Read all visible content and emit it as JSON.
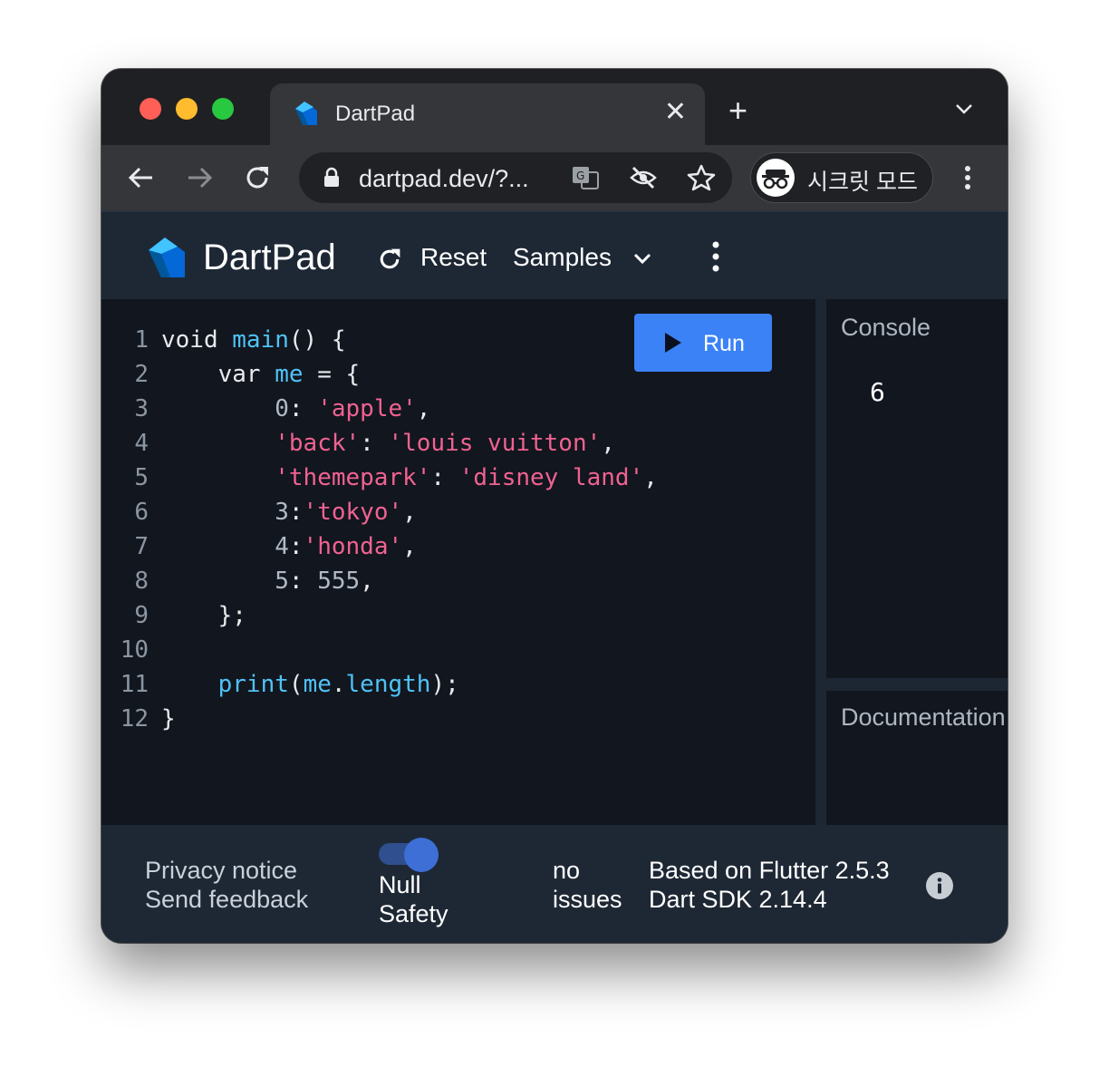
{
  "browser": {
    "tab_title": "DartPad",
    "url": "dartpad.dev/?...",
    "incognito_label": "시크릿 모드",
    "colors": {
      "close": "#ff5f57",
      "minimize": "#febc2e",
      "zoom": "#28c840"
    }
  },
  "app": {
    "name": "DartPad",
    "reset_label": "Reset",
    "samples_label": "Samples",
    "run_label": "Run"
  },
  "editor": {
    "line_numbers": [
      "1",
      "2",
      "3",
      "4",
      "5",
      "6",
      "7",
      "8",
      "9",
      "10",
      "11",
      "12"
    ],
    "lines": [
      [
        [
          "kw",
          "void "
        ],
        [
          "fn",
          "main"
        ],
        [
          "kw",
          "() {"
        ]
      ],
      [
        [
          "kw",
          "    var "
        ],
        [
          "fn",
          "me"
        ],
        [
          "kw",
          " = {"
        ]
      ],
      [
        [
          "num",
          "        0"
        ],
        [
          "kw",
          ": "
        ],
        [
          "str",
          "'apple'"
        ],
        [
          "kw",
          ","
        ]
      ],
      [
        [
          "kw",
          "        "
        ],
        [
          "str",
          "'back'"
        ],
        [
          "kw",
          ": "
        ],
        [
          "str",
          "'louis vuitton'"
        ],
        [
          "kw",
          ","
        ]
      ],
      [
        [
          "kw",
          "        "
        ],
        [
          "str",
          "'themepark'"
        ],
        [
          "kw",
          ": "
        ],
        [
          "str",
          "'disney land'"
        ],
        [
          "kw",
          ","
        ]
      ],
      [
        [
          "num",
          "        3"
        ],
        [
          "kw",
          ":"
        ],
        [
          "str",
          "'tokyo'"
        ],
        [
          "kw",
          ","
        ]
      ],
      [
        [
          "num",
          "        4"
        ],
        [
          "kw",
          ":"
        ],
        [
          "str",
          "'honda'"
        ],
        [
          "kw",
          ","
        ]
      ],
      [
        [
          "num",
          "        5"
        ],
        [
          "kw",
          ": "
        ],
        [
          "num",
          "555"
        ],
        [
          "kw",
          ","
        ]
      ],
      [
        [
          "kw",
          "    };"
        ]
      ],
      [
        [
          "kw",
          ""
        ]
      ],
      [
        [
          "kw",
          "    "
        ],
        [
          "fn",
          "print"
        ],
        [
          "kw",
          "("
        ],
        [
          "fn",
          "me"
        ],
        [
          "kw",
          "."
        ],
        [
          "fn",
          "length"
        ],
        [
          "kw",
          ");"
        ]
      ],
      [
        [
          "kw",
          "}"
        ]
      ]
    ]
  },
  "console": {
    "title": "Console",
    "output": "6"
  },
  "docs": {
    "title": "Documentation"
  },
  "footer": {
    "privacy": "Privacy notice",
    "feedback": "Send feedback",
    "null_safety_line1": "Null",
    "null_safety_line2": "Safety",
    "issues_line1": "no",
    "issues_line2": "issues",
    "flutter_version": "Based on Flutter 2.5.3",
    "sdk_version": "Dart SDK 2.14.4"
  }
}
